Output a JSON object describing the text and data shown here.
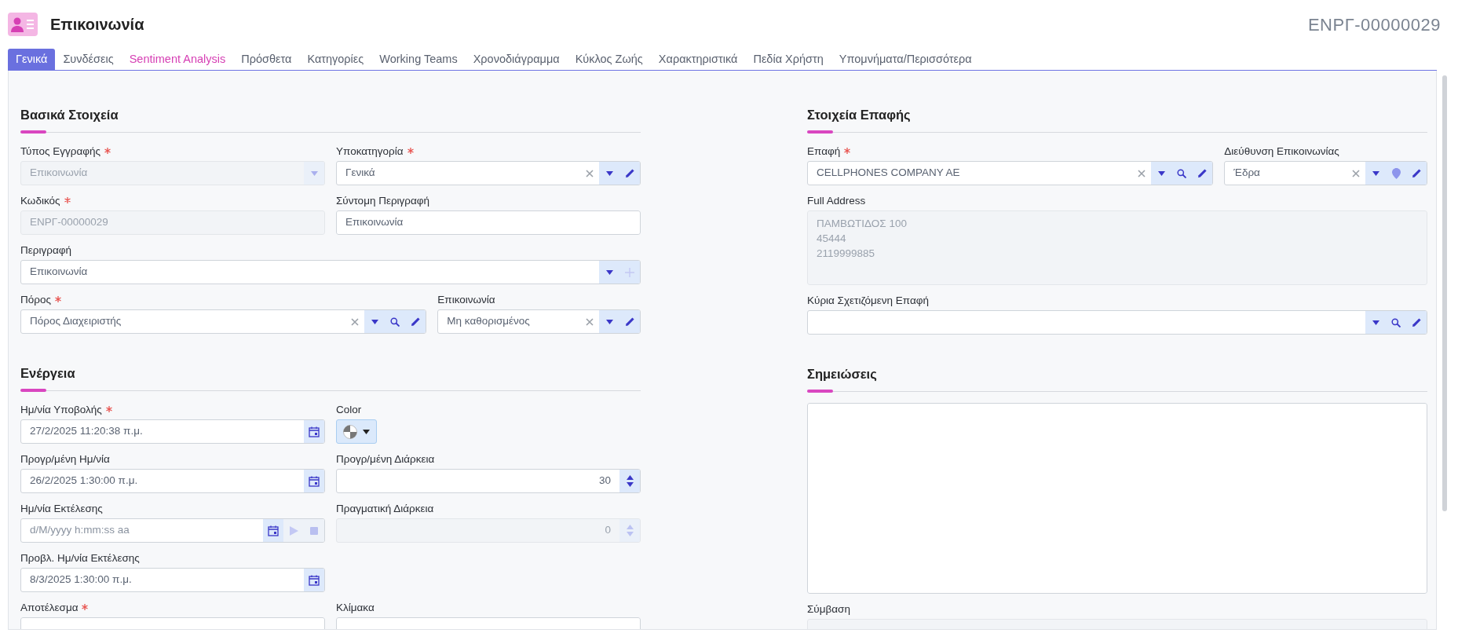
{
  "header": {
    "title": "Επικοινωνία",
    "record_code": "ΕΝΡΓ-00000029"
  },
  "tabs": [
    {
      "label": "Γενικά",
      "selected": true,
      "kind": "standard"
    },
    {
      "label": "Συνδέσεις",
      "selected": false,
      "kind": "standard"
    },
    {
      "label": "Sentiment Analysis",
      "selected": false,
      "kind": "accent"
    },
    {
      "label": "Πρόσθετα",
      "selected": false,
      "kind": "standard"
    },
    {
      "label": "Κατηγορίες",
      "selected": false,
      "kind": "standard"
    },
    {
      "label": "Working Teams",
      "selected": false,
      "kind": "standard"
    },
    {
      "label": "Χρονοδιάγραμμα",
      "selected": false,
      "kind": "standard"
    },
    {
      "label": "Κύκλος Ζωής",
      "selected": false,
      "kind": "standard"
    },
    {
      "label": "Χαρακτηριστικά",
      "selected": false,
      "kind": "standard"
    },
    {
      "label": "Πεδία Χρήστη",
      "selected": false,
      "kind": "standard"
    },
    {
      "label": "Υπομνήματα/Περισσότερα",
      "selected": false,
      "kind": "standard"
    }
  ],
  "columns": [
    {
      "sections": [
        {
          "title": "Βασικά Στοιχεία",
          "rows": [
            [
              {
                "label": "Τύπος Εγγραφής",
                "required": true,
                "kind": "select",
                "value": "Επικοινωνία",
                "disabled": true,
                "buttons": [
                  {
                    "kind": "dropdown",
                    "disabled": true
                  }
                ]
              },
              {
                "label": "Υποκατηγορία",
                "required": true,
                "kind": "select",
                "value": "Γενικά",
                "disabled": false,
                "buttons": [
                  {
                    "kind": "clear",
                    "disabled": false
                  },
                  {
                    "kind": "dropdown",
                    "disabled": false
                  },
                  {
                    "kind": "edit",
                    "disabled": false
                  }
                ]
              }
            ],
            [
              {
                "label": "Κωδικός",
                "required": true,
                "kind": "text",
                "value": "ΕΝΡΓ-00000029",
                "disabled": true
              },
              {
                "label": "Σύντομη Περιγραφή",
                "required": false,
                "kind": "text",
                "value": "Επικοινωνία",
                "disabled": false
              }
            ],
            [
              {
                "label": "Περιγραφή",
                "required": false,
                "kind": "select",
                "value": "Επικοινωνία",
                "disabled": false,
                "buttons": [
                  {
                    "kind": "dropdown",
                    "disabled": false
                  },
                  {
                    "kind": "add",
                    "disabled": true
                  }
                ]
              }
            ],
            [
              {
                "label": "Πόρος",
                "required": true,
                "kind": "select",
                "value": "Πόρος Διαχειριστής",
                "disabled": false,
                "buttons": [
                  {
                    "kind": "clear",
                    "disabled": false
                  },
                  {
                    "kind": "dropdown",
                    "disabled": false
                  },
                  {
                    "kind": "search",
                    "disabled": false
                  },
                  {
                    "kind": "edit",
                    "disabled": false
                  }
                ]
              },
              {
                "label": "Επικοινωνία",
                "required": false,
                "kind": "select",
                "value": "Μη καθορισμένος",
                "disabled": false,
                "buttons": [
                  {
                    "kind": "clear",
                    "disabled": false
                  },
                  {
                    "kind": "dropdown",
                    "disabled": false
                  },
                  {
                    "kind": "edit",
                    "disabled": false
                  }
                ]
              }
            ]
          ]
        },
        {
          "title": "Ενέργεια",
          "rows": [
            [
              {
                "label": "Ημ/νία Υποβολής",
                "required": true,
                "kind": "date",
                "value": "27/2/2025 11:20:38 π.μ.",
                "disabled": false,
                "buttons": [
                  {
                    "kind": "calendar",
                    "disabled": false
                  }
                ]
              },
              {
                "label": "Color",
                "required": false,
                "kind": "color",
                "buttons": [
                  {
                    "kind": "dropdown"
                  }
                ]
              }
            ],
            [
              {
                "label": "Προγρ/μένη Ημ/νία",
                "required": false,
                "kind": "date",
                "value": "26/2/2025 1:30:00 π.μ.",
                "disabled": false,
                "buttons": [
                  {
                    "kind": "calendar",
                    "disabled": false
                  }
                ]
              },
              {
                "label": "Προγρ/μένη Διάρκεια",
                "required": false,
                "kind": "number",
                "value": "30",
                "disabled": false,
                "buttons": [
                  {
                    "kind": "spin",
                    "disabled": false
                  }
                ]
              }
            ],
            [
              {
                "label": "Ημ/νία Εκτέλεσης",
                "required": false,
                "kind": "date",
                "placeholder": "d/M/yyyy h:mm:ss aa",
                "disabled": false,
                "buttons": [
                  {
                    "kind": "calendar",
                    "disabled": false
                  },
                  {
                    "kind": "play",
                    "disabled": true
                  },
                  {
                    "kind": "stop",
                    "disabled": true
                  }
                ]
              },
              {
                "label": "Πραγματική Διάρκεια",
                "required": false,
                "kind": "number",
                "value": "0",
                "disabled": true,
                "buttons": [
                  {
                    "kind": "spin",
                    "disabled": true
                  }
                ]
              }
            ],
            [
              {
                "label": "Προβλ. Ημ/νία Εκτέλεσης",
                "required": false,
                "kind": "date",
                "value": "8/3/2025 1:30:00 π.μ.",
                "disabled": false,
                "buttons": [
                  {
                    "kind": "calendar",
                    "disabled": false
                  }
                ]
              },
              null
            ],
            [
              {
                "label": "Αποτέλεσμα",
                "required": true,
                "kind": "select",
                "disabled": false
              },
              {
                "label": "Κλίμακα",
                "required": false,
                "kind": "select",
                "disabled": false
              }
            ]
          ]
        }
      ]
    },
    {
      "sections": [
        {
          "title": "Στοιχεία Επαφής",
          "rows": [
            [
              {
                "label": "Επαφή",
                "required": true,
                "kind": "select",
                "value": "CELLPHONES COMPANY AE",
                "disabled": false,
                "buttons": [
                  {
                    "kind": "clear",
                    "disabled": false
                  },
                  {
                    "kind": "dropdown",
                    "disabled": false
                  },
                  {
                    "kind": "search",
                    "disabled": false
                  },
                  {
                    "kind": "edit",
                    "disabled": false
                  }
                ]
              },
              {
                "label": "Διεύθυνση Επικοινωνίας",
                "required": false,
                "kind": "select",
                "value": "Έδρα",
                "disabled": false,
                "buttons": [
                  {
                    "kind": "clear",
                    "disabled": false
                  },
                  {
                    "kind": "dropdown",
                    "disabled": false
                  },
                  {
                    "kind": "location",
                    "disabled": false
                  },
                  {
                    "kind": "edit",
                    "disabled": false
                  }
                ]
              }
            ],
            [
              {
                "label": "Full Address",
                "required": false,
                "kind": "textarea",
                "lines": [
                  "ΠΑΜΒΩΤΙΔΟΣ 100",
                  "45444",
                  "2119999885"
                ],
                "disabled": true
              }
            ],
            [
              {
                "label": "Κύρια Σχετιζόμενη Επαφή",
                "required": false,
                "kind": "select",
                "disabled": false,
                "buttons": [
                  {
                    "kind": "dropdown",
                    "disabled": false
                  },
                  {
                    "kind": "search",
                    "disabled": false
                  },
                  {
                    "kind": "edit",
                    "disabled": false
                  }
                ]
              }
            ]
          ]
        },
        {
          "title": "Σημειώσεις",
          "rows": [
            [
              {
                "kind": "textarea",
                "disabled": false
              }
            ],
            [
              {
                "label": "Σύμβαση",
                "required": false,
                "kind": "select",
                "disabled": true
              }
            ]
          ]
        }
      ]
    }
  ]
}
